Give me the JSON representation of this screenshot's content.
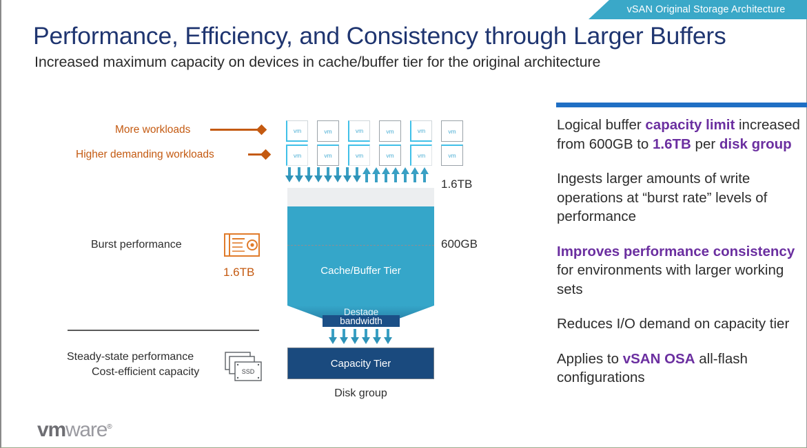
{
  "banner": {
    "label": "vSAN Original Storage Architecture",
    "color": "#3aa8c8"
  },
  "header": {
    "title": "Performance, Efficiency, and Consistency through Larger Buffers",
    "subtitle": "Increased maximum capacity on devices in cache/buffer tier for the original architecture",
    "title_color": "#1f3570"
  },
  "right_panel": {
    "accent_color": "#1f6fc4",
    "highlight_color": "#6b2fa0",
    "paragraphs": [
      {
        "id": "p1",
        "parts": [
          {
            "text": "Logical buffer ",
            "style": "normal"
          },
          {
            "text": "capacity limit",
            "style": "highlight"
          },
          {
            "text": " increased from 600GB to ",
            "style": "normal"
          },
          {
            "text": "1.6TB",
            "style": "highlight"
          },
          {
            "text": " per ",
            "style": "normal"
          },
          {
            "text": "disk group",
            "style": "highlight"
          }
        ]
      },
      {
        "id": "p2",
        "parts": [
          {
            "text": "Ingests larger amounts of write operations at “burst rate” levels of performance",
            "style": "normal"
          }
        ]
      },
      {
        "id": "p3",
        "parts": [
          {
            "text": "Improves performance consistency",
            "style": "highlight"
          },
          {
            "text": " for environments with larger working sets",
            "style": "normal"
          }
        ]
      },
      {
        "id": "p4",
        "parts": [
          {
            "text": "Reduces I/O demand on capacity tier",
            "style": "normal"
          }
        ]
      },
      {
        "id": "p5",
        "parts": [
          {
            "text": "Applies to ",
            "style": "normal"
          },
          {
            "text": "vSAN OSA",
            "style": "highlight"
          },
          {
            "text": " all-flash configurations",
            "style": "normal"
          }
        ]
      }
    ]
  },
  "diagram": {
    "label_more_workloads": "More workloads",
    "label_higher_workloads": "Higher demanding workloads",
    "label_burst_performance": "Burst performance",
    "label_burst_capacity": "1.6TB",
    "label_steady_state": "Steady-state performance",
    "label_cost_efficient": "Cost-efficient capacity",
    "label_ssd_icon": "SSD",
    "vm_label": "vm",
    "vm_count_row1": 6,
    "vm_count_row2": 6,
    "down_arrow_count": 8,
    "up_arrow_count": 7,
    "destage_arrow_count": 6,
    "tick_top": "1.6TB",
    "tick_mid": "600GB",
    "buffer_tier_label": "Cache/Buffer Tier",
    "destage_label_line1": "Destage",
    "destage_label_line2": "bandwidth",
    "capacity_tier_label": "Capacity Tier",
    "disk_group_label": "Disk group",
    "orange_color": "#c45a11",
    "teal_color": "#35a6c9",
    "navy_color": "#1a4a7e"
  },
  "footer": {
    "logo_bold": "vm",
    "logo_light": "ware",
    "logo_mark": "®"
  }
}
